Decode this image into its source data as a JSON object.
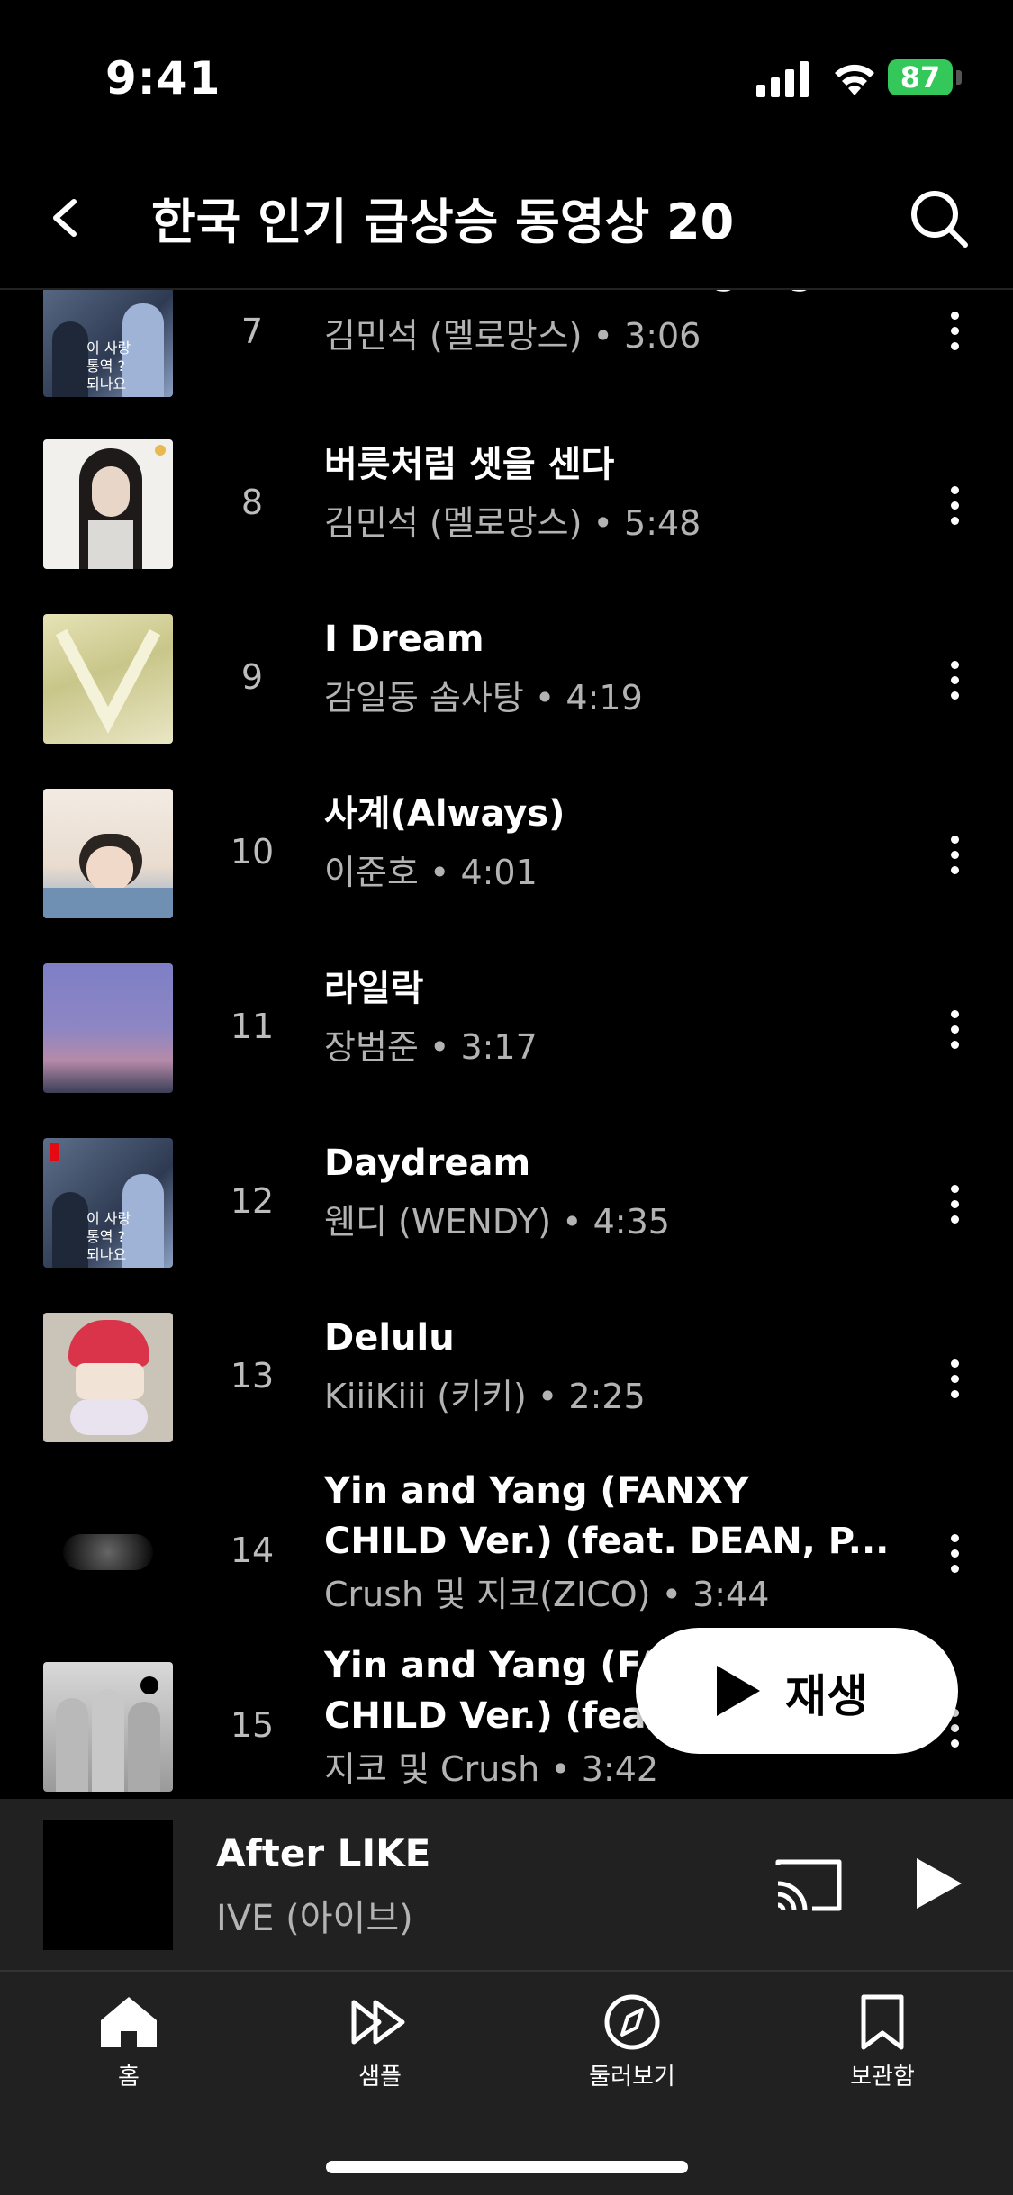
{
  "status": {
    "time": "9:41",
    "battery": "87"
  },
  "header": {
    "title": "한국 인기 급상승 동영상 20"
  },
  "tracks": [
    {
      "rank": "7",
      "title": "사랑의 언어 (Love Language)",
      "title2": "",
      "meta": "김민석 (멜로망스) • 3:06",
      "art": "couple"
    },
    {
      "rank": "8",
      "title": "버릇처럼 셋을 센다",
      "title2": "",
      "meta": "김민석 (멜로망스) • 5:48",
      "art": "woman"
    },
    {
      "rank": "9",
      "title": "I Dream",
      "title2": "",
      "meta": "감일동 솜사탕 • 4:19",
      "art": "yellow"
    },
    {
      "rank": "10",
      "title": "사계(Always)",
      "title2": "",
      "meta": "이준호 • 4:01",
      "art": "sagye"
    },
    {
      "rank": "11",
      "title": "라일락",
      "title2": "",
      "meta": "장범준 • 3:17",
      "art": "purple"
    },
    {
      "rank": "12",
      "title": "Daydream",
      "title2": "",
      "meta": "웬디 (WENDY) • 4:35",
      "art": "couple"
    },
    {
      "rank": "13",
      "title": "Delulu",
      "title2": "",
      "meta": "KiiiKiii (키키) • 2:25",
      "art": "red"
    },
    {
      "rank": "14",
      "title": "Yin and Yang (FANXY",
      "title2": "CHILD Ver.) (feat. DEAN, P...",
      "meta": "Crush 및 지코(ZICO) • 3:44",
      "art": "dark"
    },
    {
      "rank": "15",
      "title": "Yin and Yang (FANXY",
      "title2": "CHILD Ver.) (feat.",
      "meta": "지코 및 Crush • 3:42",
      "art": "monkeys"
    }
  ],
  "play_button": {
    "label": "재생"
  },
  "mini_player": {
    "title": "After LIKE",
    "artist": "IVE (아이브)"
  },
  "nav": [
    {
      "label": "홈",
      "icon": "home-icon"
    },
    {
      "label": "샘플",
      "icon": "samples-icon"
    },
    {
      "label": "둘러보기",
      "icon": "explore-icon"
    },
    {
      "label": "보관함",
      "icon": "library-icon"
    }
  ],
  "colors": {
    "background": "#000000",
    "mini_player": "#212121",
    "battery": "#34c759"
  }
}
